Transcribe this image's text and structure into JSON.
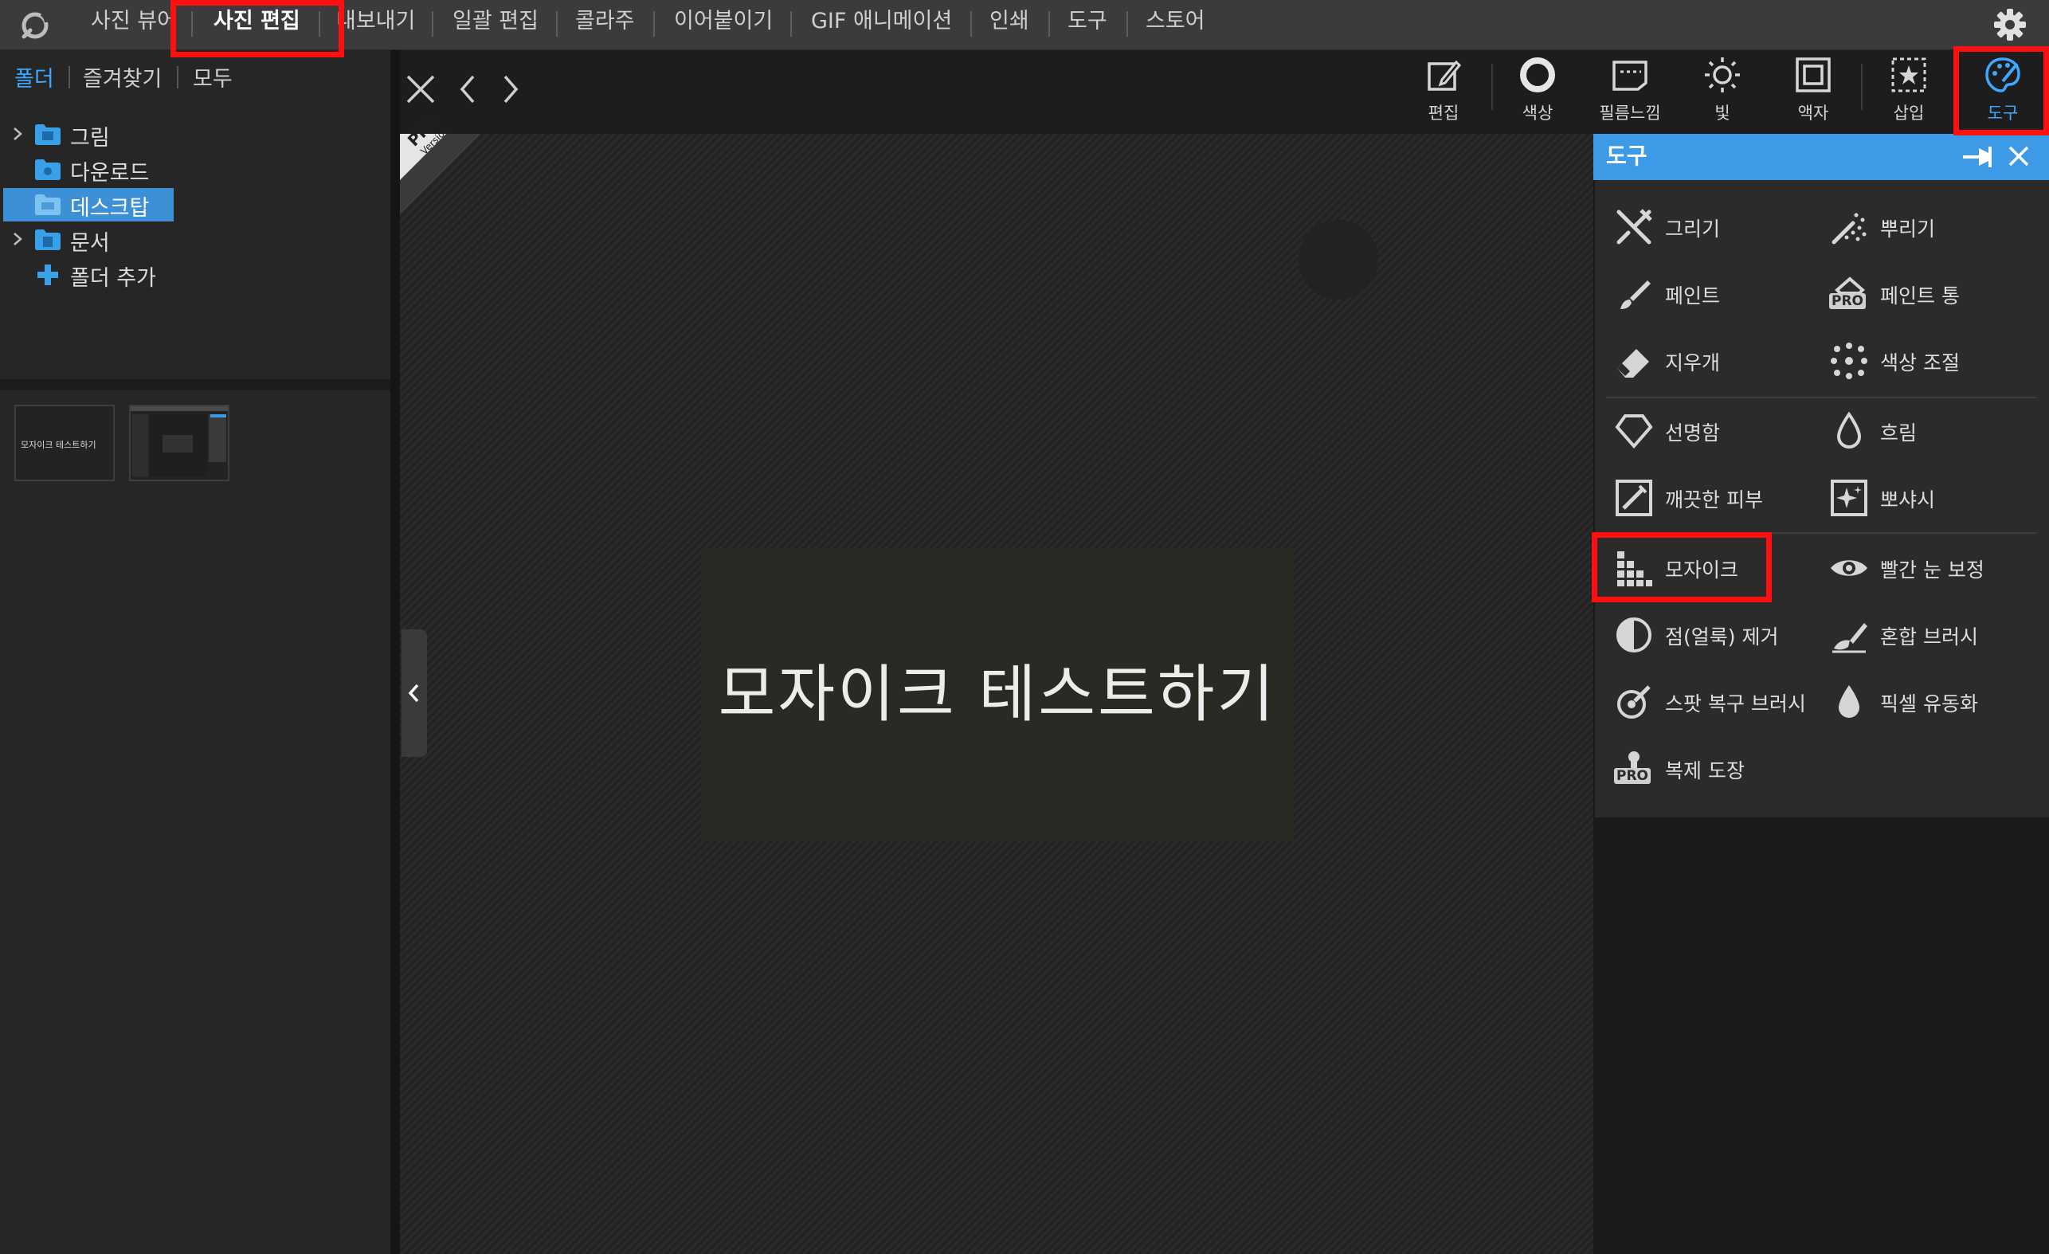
{
  "menubar": {
    "items": [
      "사진 뷰어",
      "사진 편집",
      "내보내기",
      "일괄 편집",
      "콜라주",
      "이어붙이기",
      "GIF 애니메이션",
      "인쇄",
      "도구",
      "스토어"
    ],
    "active": "사진 편집"
  },
  "left_panel": {
    "tabs": [
      "폴더",
      "즐겨찾기",
      "모두"
    ],
    "active_tab": "폴더",
    "tree": [
      {
        "label": "그림",
        "expandable": true,
        "selected": false
      },
      {
        "label": "다운로드",
        "expandable": false,
        "selected": false
      },
      {
        "label": "데스크탑",
        "expandable": false,
        "selected": true
      },
      {
        "label": "문서",
        "expandable": true,
        "selected": false
      },
      {
        "label": "폴더 추가",
        "expandable": false,
        "selected": false
      }
    ],
    "thumbnails": [
      {
        "caption": "모자이크 테스트하기"
      },
      {
        "caption": ""
      }
    ]
  },
  "toolbar": {
    "tools": [
      {
        "label": "편집",
        "icon": "edit-icon"
      },
      {
        "label": "색상",
        "icon": "color-circle-icon"
      },
      {
        "label": "필름느낌",
        "icon": "film-icon"
      },
      {
        "label": "빛",
        "icon": "sun-icon"
      },
      {
        "label": "액자",
        "icon": "frame-icon"
      },
      {
        "label": "삽입",
        "icon": "insert-star-icon"
      },
      {
        "label": "도구",
        "icon": "palette-icon"
      }
    ],
    "active": "도구"
  },
  "canvas": {
    "ribbon_main": "PRO",
    "ribbon_sub": "Version",
    "photo_text": "모자이크 테스트하기"
  },
  "tools_panel": {
    "title": "도구",
    "items": [
      {
        "label": "그리기",
        "icon": "draw-icon"
      },
      {
        "label": "뿌리기",
        "icon": "spray-icon"
      },
      {
        "label": "페인트",
        "icon": "brush-icon"
      },
      {
        "label": "페인트 통",
        "icon": "paint-bucket-icon",
        "badge": "PRO"
      },
      {
        "label": "지우개",
        "icon": "eraser-icon"
      },
      {
        "label": "색상 조절",
        "icon": "color-adjust-icon"
      },
      {
        "label": "선명함",
        "icon": "sharpen-icon"
      },
      {
        "label": "흐림",
        "icon": "blur-drop-icon"
      },
      {
        "label": "깨끗한 피부",
        "icon": "clean-skin-icon"
      },
      {
        "label": "뽀샤시",
        "icon": "glow-icon"
      },
      {
        "label": "모자이크",
        "icon": "mosaic-icon"
      },
      {
        "label": "빨간 눈 보정",
        "icon": "eye-icon"
      },
      {
        "label": "점(얼룩) 제거",
        "icon": "spot-remove-icon"
      },
      {
        "label": "혼합 브러시",
        "icon": "mix-brush-icon"
      },
      {
        "label": "스팟 복구 브러시",
        "icon": "spot-heal-icon"
      },
      {
        "label": "픽셀 유동화",
        "icon": "liquify-drop-icon"
      },
      {
        "label": "복제 도장",
        "icon": "clone-stamp-icon",
        "badge": "PRO"
      }
    ]
  },
  "colors": {
    "accent": "#3da8ff",
    "highlight": "#ff0f0f",
    "panel_header": "#3d9ae6"
  }
}
